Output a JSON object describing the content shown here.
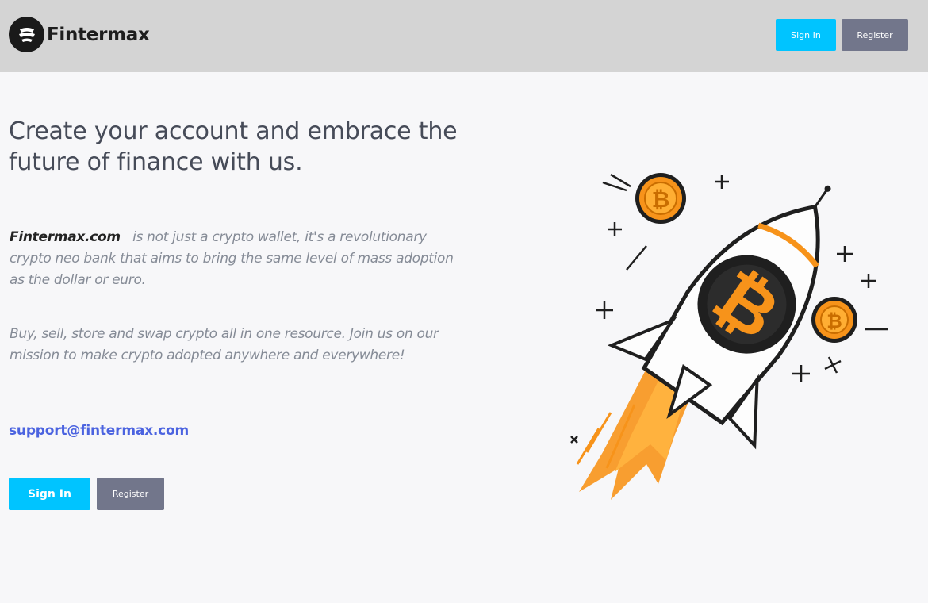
{
  "header": {
    "brand": "Fintermax",
    "signin_label": "Sign In",
    "register_label": "Register"
  },
  "hero": {
    "headline": "Create your account and embrace the future of finance with us.",
    "brand_inline": "Fintermax.com",
    "paragraph1_rest": "is not just a crypto wallet, it's a revolutionary crypto neo bank that aims to bring the same level of mass adoption as the dollar or euro.",
    "paragraph2": "Buy, sell, store and swap crypto all in one resource. Join us on our mission to make crypto adopted anywhere and everywhere!",
    "email": "support@fintermax.com",
    "signin_label": "Sign In",
    "register_label": "Register"
  },
  "illustration": {
    "icon": "bitcoin-rocket-illustration",
    "coin_symbol": "₿"
  },
  "colors": {
    "header_bg": "#d4d4d4",
    "page_bg": "#f7f7f9",
    "primary": "#00c4ff",
    "secondary": "#72768b",
    "link": "#4b63e0",
    "orange": "#f7931a"
  }
}
